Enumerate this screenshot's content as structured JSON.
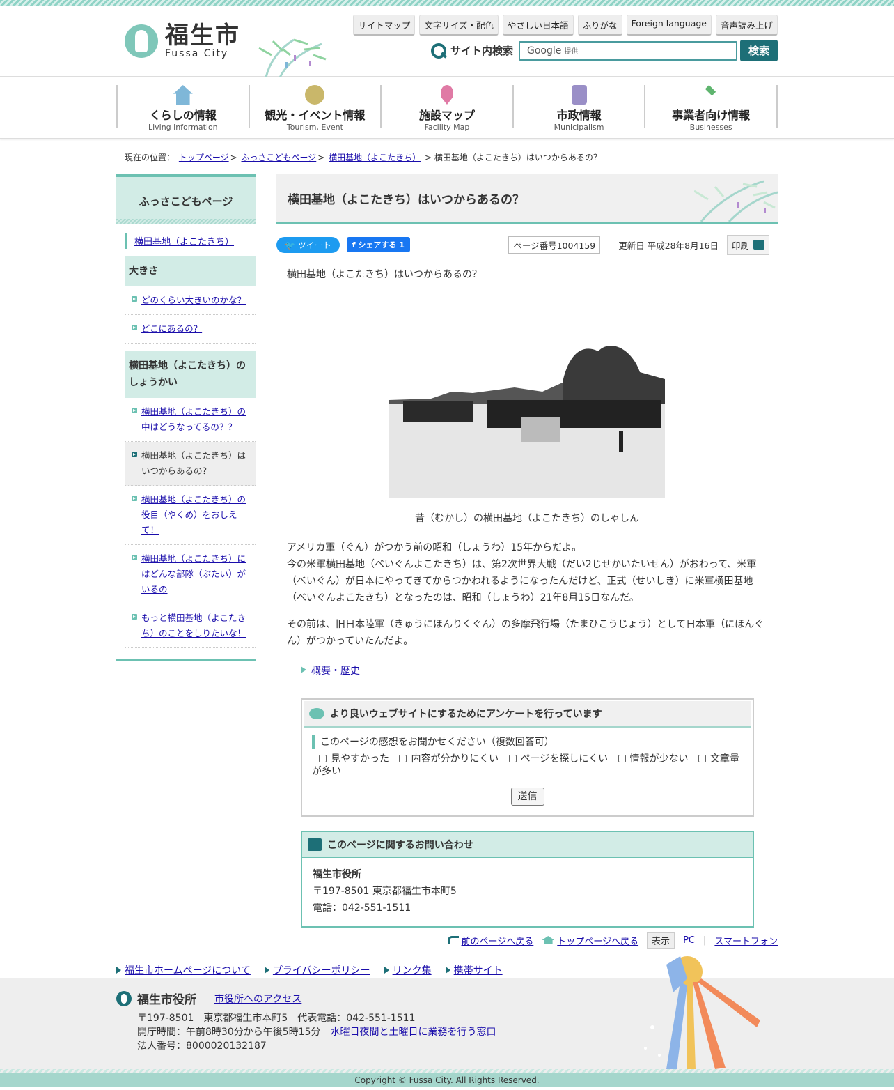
{
  "header": {
    "logo_jp": "福生市",
    "logo_en": "Fussa City",
    "util": [
      "サイトマップ",
      "文字サイズ・配色",
      "やさしい日本語",
      "ふりがな",
      "Foreign language",
      "音声読み上げ"
    ],
    "search_label": "サイト内検索",
    "search_google": "Google",
    "search_provided": "提供",
    "search_button": "検索"
  },
  "gnav": [
    {
      "jp": "くらしの情報",
      "en": "Living information",
      "color": "#7fb7d8"
    },
    {
      "jp": "観光・イベント情報",
      "en": "Tourism, Event",
      "color": "#c9b76a"
    },
    {
      "jp": "施設マップ",
      "en": "Facility Map",
      "color": "#e07aa5"
    },
    {
      "jp": "市政情報",
      "en": "Municipalism",
      "color": "#9a8fc7"
    },
    {
      "jp": "事業者向け情報",
      "en": "Businesses",
      "color": "#5fb56f"
    }
  ],
  "breadcrumb": {
    "prefix": "現在の位置：",
    "items": [
      "トップページ",
      "ふっさこどもページ",
      "横田基地（よこたきち）"
    ],
    "separator": ">",
    "current": "横田基地（よこたきち）はいつからあるの？"
  },
  "side": {
    "head": "ふっさこどもページ",
    "current": "横田基地（よこたきち）",
    "cat1": "大きさ",
    "cat1_links": [
      "どのくらい大きいのかな？",
      "どこにあるの？"
    ],
    "cat2": "横田基地（よこたきち）のしょうかい",
    "cat2_links": [
      "横田基地（よこたきち）の中はどうなってるの？？",
      "横田基地（よこたきち）はいつからあるの？",
      "横田基地（よこたきち）の役目（やくめ）をおしえて！",
      "横田基地（よこたきち）にはどんな部隊（ぶたい）がいるの",
      "もっと横田基地（よこたきち）のことをしりたいな！"
    ]
  },
  "content": {
    "title": "横田基地（よこたきち）はいつからあるの？",
    "tweet": "ツイート",
    "fb_share": "シェアする 1",
    "page_no": "ページ番号1004159",
    "updated": "更新日 平成28年8月16日",
    "print": "印刷",
    "lead": "横田基地（よこたきち）はいつからあるの？",
    "caption": "昔（むかし）の横田基地（よこたきち）のしゃしん",
    "para1": "アメリカ軍（ぐん）がつかう前の昭和（しょうわ）15年からだよ。",
    "para2": "今の米軍横田基地（べいぐんよこたきち）は、第2次世界大戦（だい2じせかいたいせん）がおわって、米軍（べいぐん）が日本にやってきてからつかわれるようになったんだけど、正式（せいしき）に米軍横田基地（べいぐんよこたきち）となったのは、昭和（しょうわ）21年8月15日なんだ。",
    "para3": "その前は、旧日本陸軍（きゅうにほんりくぐん）の多摩飛行場（たまひこうじょう）として日本軍（にほんぐん）がつかっていたんだよ。",
    "related": "概要・歴史"
  },
  "survey": {
    "title": "より良いウェブサイトにするためにアンケートを行っています",
    "question": "このページの感想をお聞かせください（複数回答可）",
    "options": [
      "見やすかった",
      "内容が分かりにくい",
      "ページを探しにくい",
      "情報が少ない",
      "文章量が多い"
    ],
    "submit": "送信"
  },
  "contact": {
    "title": "このページに関するお問い合わせ",
    "org": "福生市役所",
    "address": "〒197-8501 東京都福生市本町5",
    "phone": "電話：042-551-1511"
  },
  "pagenav": {
    "back": "前のページへ戻る",
    "top": "トップページへ戻る",
    "view": "表示",
    "pc": "PC",
    "sp": "スマートフォン"
  },
  "footer_links": [
    "福生市ホームページについて",
    "プライバシーポリシー",
    "リンク集",
    "携帯サイト"
  ],
  "footer": {
    "name": "福生市役所",
    "access": "市役所へのアクセス",
    "address": "〒197-8501　東京都福生市本町5　代表電話：042-551-1511",
    "hours": "開庁時間：午前8時30分から午後5時15分",
    "hours_link": "水曜日夜間と土曜日に業務を行う窓口",
    "corp_no": "法人番号：8000020132187",
    "copyright": "Copyright © Fussa City. All Rights Reserved."
  }
}
